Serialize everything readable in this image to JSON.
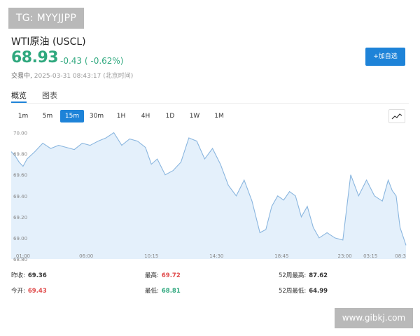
{
  "watermark_top": "TG: MYYJJPP",
  "watermark_bottom": "www.gibkj.com",
  "quote": {
    "title": "WTI原油 (USCL)",
    "price": "68.93",
    "change": "-0.43 ( -0.62%)",
    "status": "交易中,",
    "timestamp": "2025-03-31 08:43:17 (北京时间)",
    "add_label": "+加自选"
  },
  "tabs": [
    "概览",
    "图表"
  ],
  "ranges": [
    "1m",
    "5m",
    "15m",
    "30m",
    "1H",
    "4H",
    "1D",
    "1W",
    "1M"
  ],
  "active_range": "15m",
  "stats": {
    "prev_close_label": "昨收:",
    "prev_close": "69.36",
    "high_label": "最高:",
    "high": "69.72",
    "high52_label": "52周最高:",
    "high52": "87.62",
    "open_label": "今开:",
    "open": "69.43",
    "low_label": "最低:",
    "low": "68.81",
    "low52_label": "52周最低:",
    "low52": "64.99"
  },
  "colors": {
    "up": "#e04a4a",
    "down": "#2fa87e",
    "accent": "#1e83d8",
    "area": "#e4f0fb",
    "line": "#8ab6df"
  },
  "chart_data": {
    "type": "area",
    "ylim": [
      68.8,
      70.05
    ],
    "y_ticks": [
      "70.00",
      "69.80",
      "69.60",
      "69.40",
      "69.20",
      "69.00",
      "68.80"
    ],
    "x_ticks": [
      "01:00",
      "06:00",
      "10:15",
      "14:30",
      "18:45",
      "23:00",
      "03:15",
      "08:3"
    ],
    "x_tick_pos": [
      0.03,
      0.19,
      0.355,
      0.52,
      0.685,
      0.845,
      0.91,
      1.0
    ],
    "series": [
      {
        "x": [
          0,
          0.01,
          0.02,
          0.03,
          0.04,
          0.06,
          0.08,
          0.1,
          0.12,
          0.14,
          0.16,
          0.18,
          0.2,
          0.22,
          0.24,
          0.26,
          0.28,
          0.3,
          0.32,
          0.34,
          0.355,
          0.37,
          0.39,
          0.41,
          0.43,
          0.45,
          0.47,
          0.49,
          0.51,
          0.53,
          0.55,
          0.57,
          0.59,
          0.61,
          0.63,
          0.645,
          0.66,
          0.675,
          0.69,
          0.705,
          0.72,
          0.735,
          0.75,
          0.765,
          0.78,
          0.8,
          0.82,
          0.84,
          0.86,
          0.88,
          0.9,
          0.92,
          0.94,
          0.955,
          0.965,
          0.975,
          0.985,
          1.0
        ],
        "y": [
          69.82,
          69.78,
          69.72,
          69.68,
          69.75,
          69.82,
          69.9,
          69.85,
          69.88,
          69.86,
          69.84,
          69.9,
          69.88,
          69.92,
          69.95,
          70.0,
          69.88,
          69.94,
          69.92,
          69.86,
          69.7,
          69.75,
          69.6,
          69.64,
          69.72,
          69.95,
          69.92,
          69.75,
          69.85,
          69.7,
          69.5,
          69.4,
          69.55,
          69.35,
          69.05,
          69.08,
          69.3,
          69.4,
          69.36,
          69.44,
          69.4,
          69.2,
          69.3,
          69.1,
          69.0,
          69.05,
          69.0,
          68.98,
          69.6,
          69.4,
          69.55,
          69.4,
          69.35,
          69.55,
          69.45,
          69.4,
          69.1,
          68.93
        ]
      }
    ]
  }
}
